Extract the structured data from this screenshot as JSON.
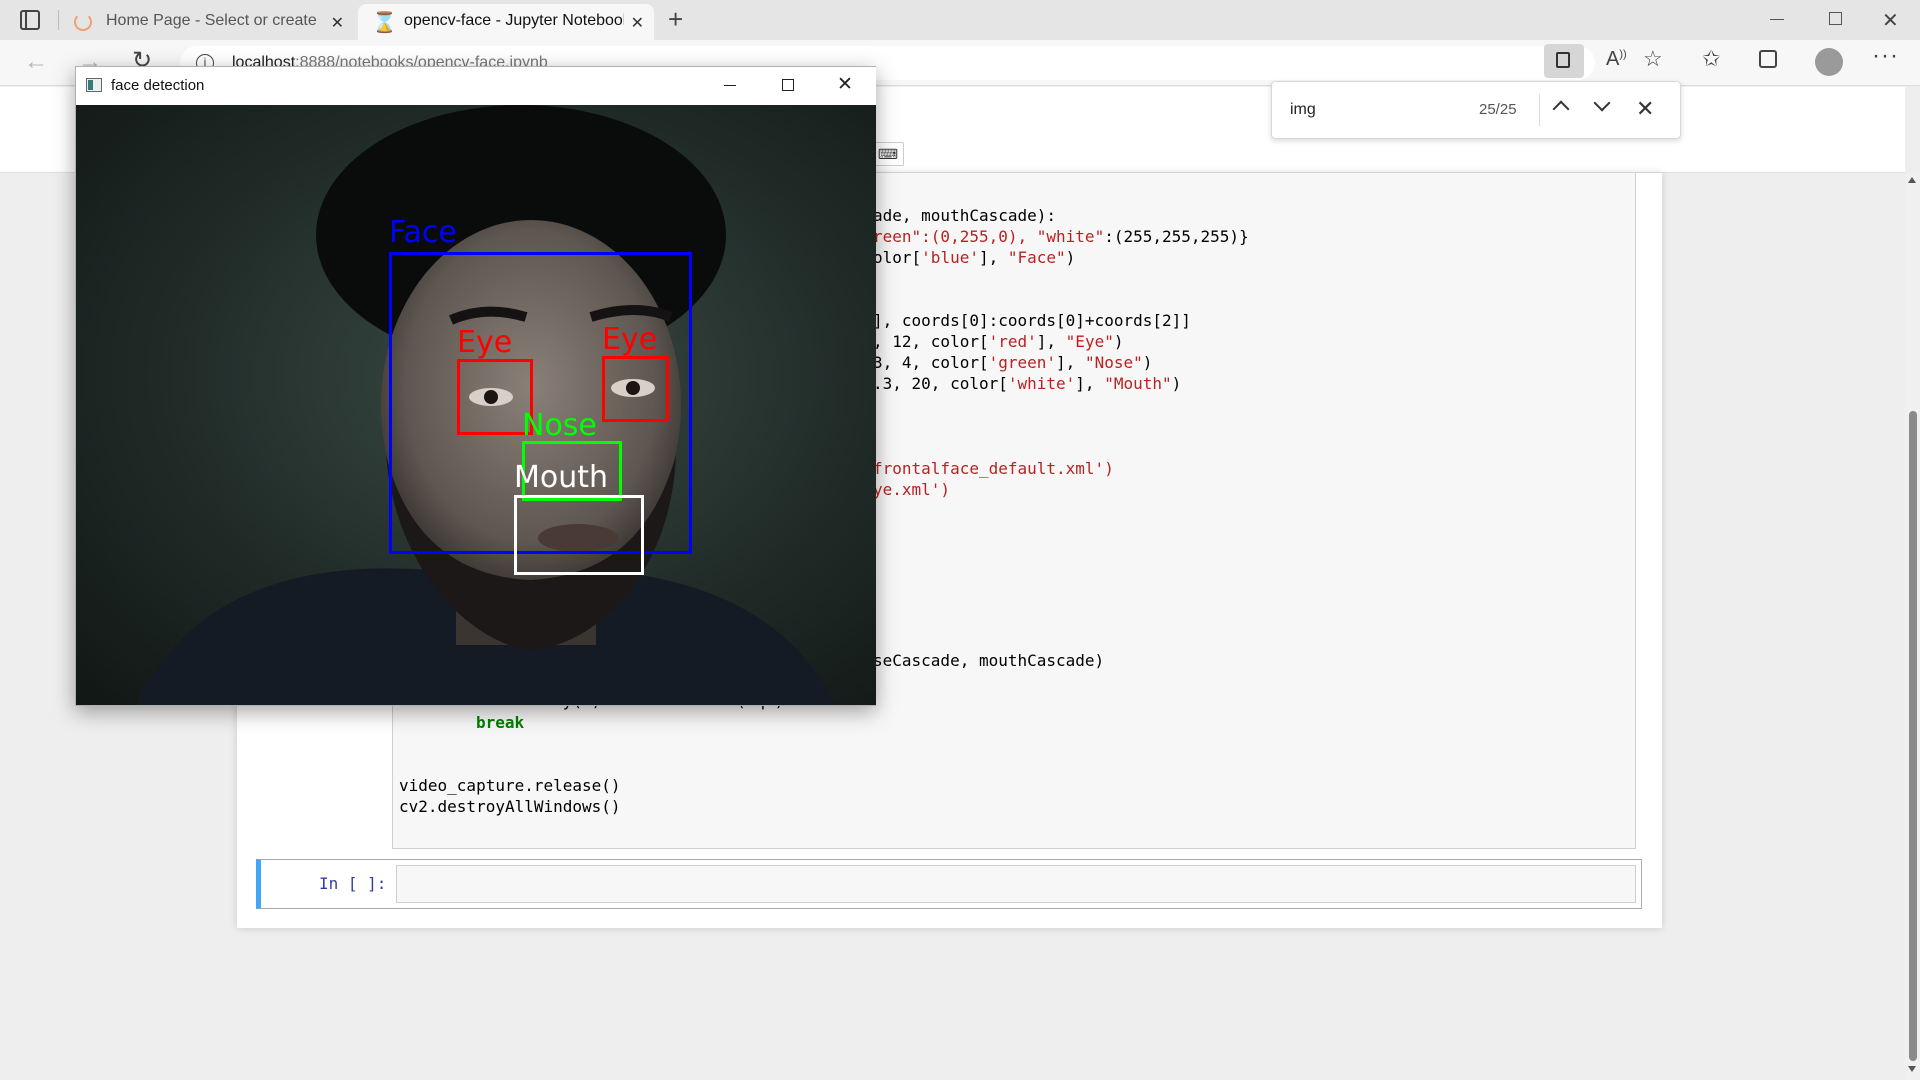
{
  "browser": {
    "tabs": [
      {
        "title": "Home Page - Select or create a n",
        "active": false
      },
      {
        "title": "opencv-face - Jupyter Notebook",
        "active": true
      }
    ],
    "url_host": "localhost",
    "url_path": ":8888/notebooks/opencv-face.ipynb"
  },
  "findbar": {
    "query": "img",
    "count": "25/25"
  },
  "cv_window": {
    "title": "face detection"
  },
  "detections": [
    {
      "label": "Face",
      "color": "#0000ff"
    },
    {
      "label": "Eye",
      "color": "#ff0000"
    },
    {
      "label": "Eye",
      "color": "#ff0000"
    },
    {
      "label": "Nose",
      "color": "#00ff00"
    },
    {
      "label": "Mouth",
      "color": "#ffffff"
    }
  ],
  "code": {
    "line1": "ade, mouthCascade):",
    "line2a": "reen\":(0,255,0), ",
    "line2b": "\"white\"",
    "line2c": ":(255,255,255)}",
    "line3a": "olor[",
    "line3b": "'blue'",
    "line3c": "], ",
    "line3d": "\"Face\"",
    "line3e": ")",
    "line4": "], coords[0]:coords[0]+coords[2]]",
    "line5a": ", 12, color[",
    "line5b": "'red'",
    "line5c": "], ",
    "line5d": "\"Eye\"",
    "line5e": ")",
    "line6a": "3, 4, color[",
    "line6b": "'green'",
    "line6c": "], ",
    "line6d": "\"Nose\"",
    "line6e": ")",
    "line7a": ".3, 20, color[",
    "line7b": "'white'",
    "line7c": "], ",
    "line7d": "\"Mouth\"",
    "line7e": ")",
    "line8": "frontalface_default.xml')",
    "line9": "ye.xml')",
    "line10": "seCascade, mouthCascade)",
    "line11": "    if cv2.waitKey(1) & 0xFF == ord('q'):",
    "line12": "break",
    "line13": "video_capture.release()",
    "line14": "cv2.destroyAllWindows()"
  },
  "input_cell": {
    "prompt": "In [ ]:"
  }
}
